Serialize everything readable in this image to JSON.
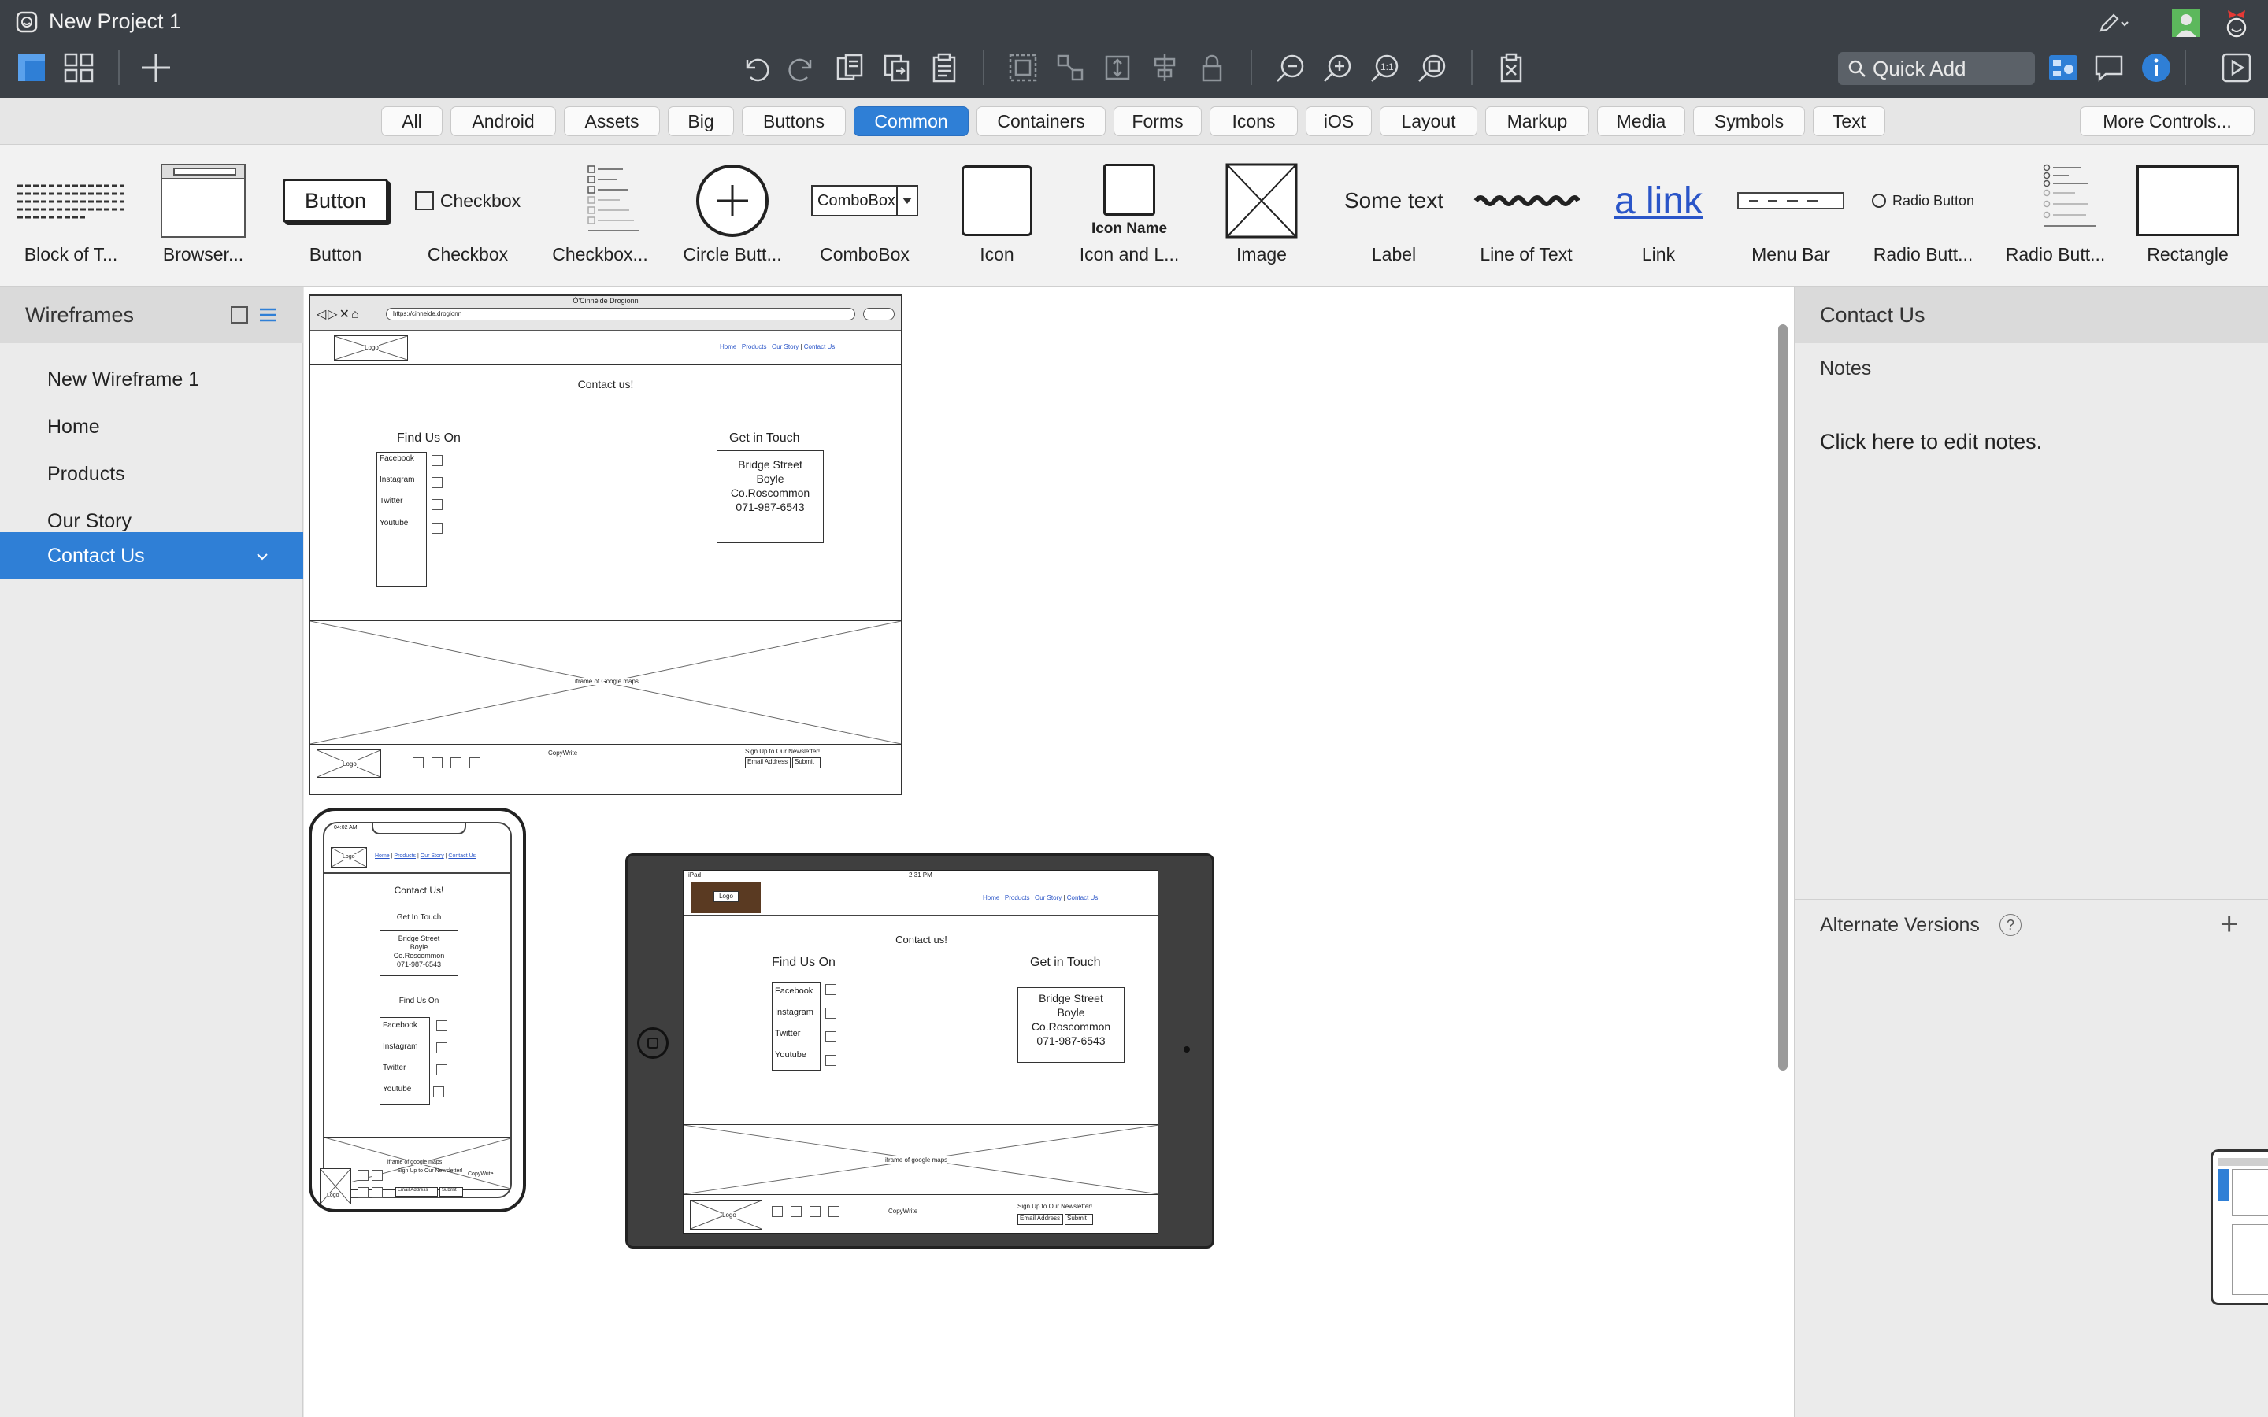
{
  "window": {
    "title": "New Project 1"
  },
  "toolbar": {
    "quick_add_placeholder": "Quick Add"
  },
  "tabs": [
    "All",
    "Android",
    "Assets",
    "Big",
    "Buttons",
    "Common",
    "Containers",
    "Forms",
    "Icons",
    "iOS",
    "Layout",
    "Markup",
    "Media",
    "Symbols",
    "Text"
  ],
  "active_tab": "Common",
  "more_controls_label": "More Controls...",
  "controls": [
    {
      "label": "Block of T...",
      "icon": "text-block-icon"
    },
    {
      "label": "Browser...",
      "icon": "browser-window-icon"
    },
    {
      "label": "Button",
      "icon": "button-icon",
      "preview": "Button"
    },
    {
      "label": "Checkbox",
      "icon": "checkbox-icon",
      "preview": "Checkbox"
    },
    {
      "label": "Checkbox...",
      "icon": "checkbox-group-icon"
    },
    {
      "label": "Circle Butt...",
      "icon": "circle-button-icon"
    },
    {
      "label": "ComboBox",
      "icon": "combobox-icon",
      "preview": "ComboBox"
    },
    {
      "label": "Icon",
      "icon": "icon-placeholder-icon"
    },
    {
      "label": "Icon and L...",
      "icon": "icon-and-label-icon",
      "preview": "Icon Name"
    },
    {
      "label": "Image",
      "icon": "image-icon"
    },
    {
      "label": "Label",
      "icon": "label-icon",
      "preview": "Some text"
    },
    {
      "label": "Line of Text",
      "icon": "line-of-text-icon"
    },
    {
      "label": "Link",
      "icon": "link-icon",
      "preview": "a link"
    },
    {
      "label": "Menu Bar",
      "icon": "menu-bar-icon"
    },
    {
      "label": "Radio Butt...",
      "icon": "radio-button-icon",
      "preview": "Radio Button"
    },
    {
      "label": "Radio Butt...",
      "icon": "radio-group-icon"
    },
    {
      "label": "Rectangle",
      "icon": "rectangle-icon"
    }
  ],
  "left_panel": {
    "title": "Wireframes",
    "items": [
      "New Wireframe 1",
      "Home",
      "Products",
      "Our Story",
      "Contact Us"
    ],
    "selected": "Contact Us"
  },
  "right_panel": {
    "title": "Contact Us",
    "notes_label": "Notes",
    "notes_placeholder": "Click here to edit notes.",
    "alternate_versions_label": "Alternate Versions",
    "help_glyph": "?"
  },
  "wireframe": {
    "browser_title": "Ó'Cinnéide Drogionn",
    "url": "https://cinneide.drogionn",
    "logo": "Logo",
    "nav": [
      "Home",
      "Products",
      "Our Story",
      "Contact Us"
    ],
    "heading": "Contact us!",
    "mobile_heading": "Contact Us!",
    "find_us_on": "Find Us On",
    "get_in_touch": "Get in Touch",
    "mobile_get_in_touch": "Get In Touch",
    "socials": [
      "Facebook",
      "Instagram",
      "Twitter",
      "Youtube"
    ],
    "address": [
      "Bridge Street",
      "Boyle",
      "Co.Roscommon",
      "071-987-6543"
    ],
    "map_label": "iframe of Google maps",
    "mobile_map_label": "iframe of google maps",
    "copyright": "CopyWrite",
    "newsletter": "Sign Up to Our Newsletter!",
    "email_placeholder": "Email Address",
    "submit": "Submit",
    "phone_time": "04:02 AM",
    "tablet_status_left": "iPad",
    "tablet_time": "2:31 PM"
  }
}
